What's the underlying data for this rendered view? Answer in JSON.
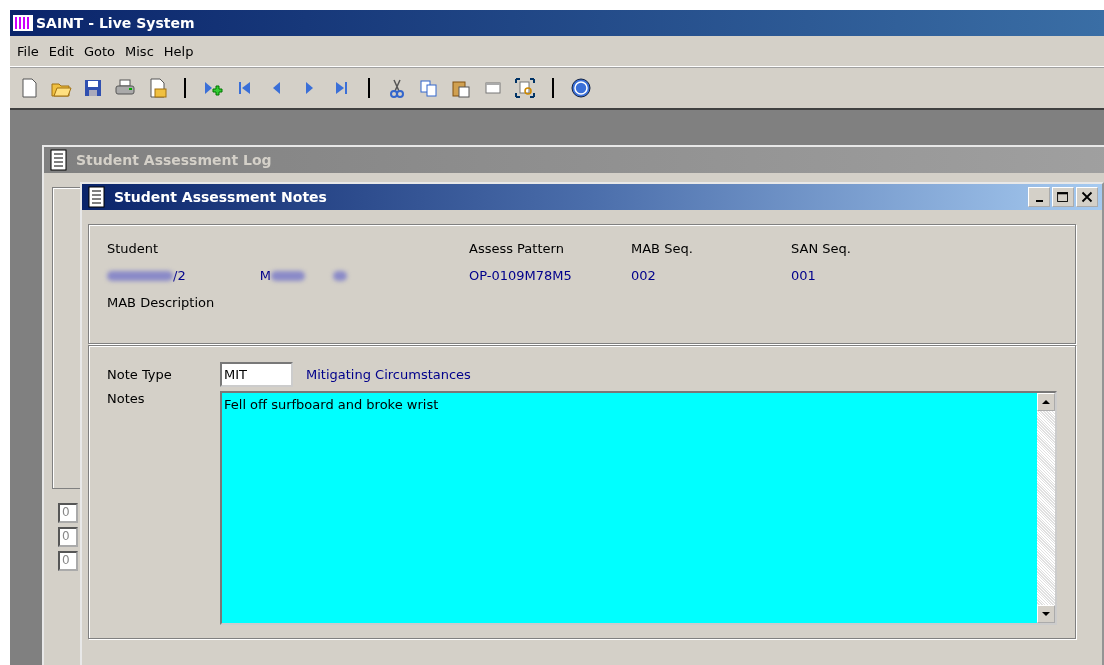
{
  "window": {
    "title": "SAINT - Live System"
  },
  "menu": [
    "File",
    "Edit",
    "Goto",
    "Misc",
    "Help"
  ],
  "background_window": {
    "title": "Student Assessment Log",
    "active": false,
    "fields": [
      "0",
      "0",
      "0"
    ]
  },
  "notes_window": {
    "title": "Student Assessment Notes",
    "active": true,
    "header": {
      "labels": [
        "Student",
        "Assess Pattern",
        "MAB Seq.",
        "SAN Seq."
      ],
      "student_id": "/2",
      "student_name": "M",
      "assess_pattern": "OP-0109M78M5",
      "mab_seq": "002",
      "san_seq": "001",
      "mab_description_label": "MAB Description"
    },
    "note_type_label": "Note Type",
    "note_type": "MIT",
    "note_type_description": "Mitigating Circumstances",
    "notes_label": "Notes",
    "notes": "Fell off surfboard and broke wrist"
  }
}
